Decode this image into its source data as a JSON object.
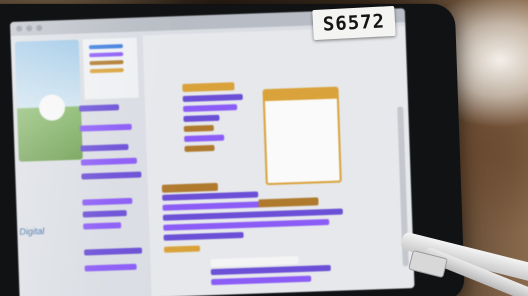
{
  "photo": {
    "subject": "",
    "device_label": "S6572"
  },
  "screen": {
    "stage_caption": "Digital"
  },
  "colors": {
    "block_purple": "#6b4fd6",
    "block_violet": "#8b5cf6",
    "block_brown": "#b07a2e",
    "block_gold": "#d9a23a",
    "workspace_bg": "#e6e8ec"
  }
}
